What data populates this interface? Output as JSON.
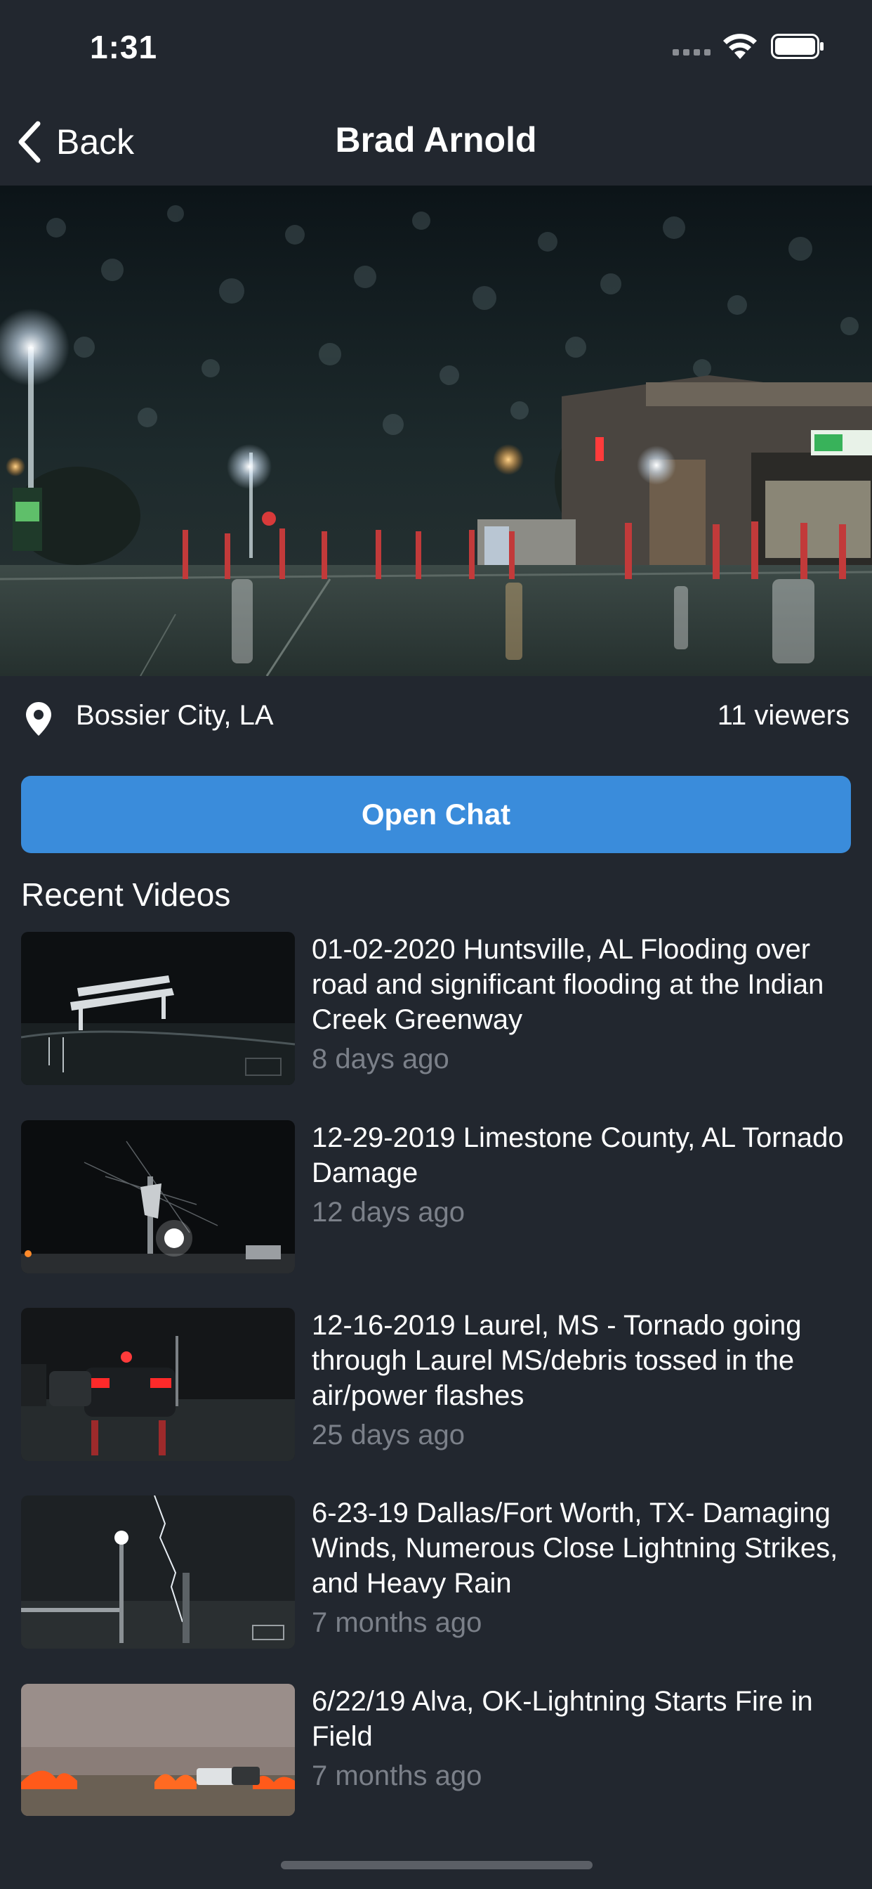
{
  "status_bar": {
    "time": "1:31"
  },
  "nav": {
    "back_label": "Back",
    "title": "Brad Arnold"
  },
  "stream": {
    "location": "Bossier City, LA",
    "viewers": "11 viewers"
  },
  "chat_button": {
    "label": "Open Chat"
  },
  "recent": {
    "heading": "Recent Videos",
    "videos": [
      {
        "title": "01-02-2020 Huntsville, AL Flooding over road and significant flooding at the Indian Creek Greenway",
        "age": "8 days ago"
      },
      {
        "title": "12-29-2019 Limestone County, AL Tornado Damage",
        "age": "12 days ago"
      },
      {
        "title": "12-16-2019 Laurel, MS - Tornado going through Laurel MS/debris tossed in the air/power flashes",
        "age": "25 days ago"
      },
      {
        "title": "6-23-19 Dallas/Fort Worth, TX- Damaging Winds, Numerous Close Lightning Strikes, and Heavy Rain",
        "age": "7 months ago"
      },
      {
        "title": "6/22/19 Alva, OK-Lightning Starts Fire in Field",
        "age": "7 months ago"
      }
    ]
  },
  "colors": {
    "background": "#22272f",
    "accent": "#3a8cdb",
    "muted": "#7b8089"
  }
}
